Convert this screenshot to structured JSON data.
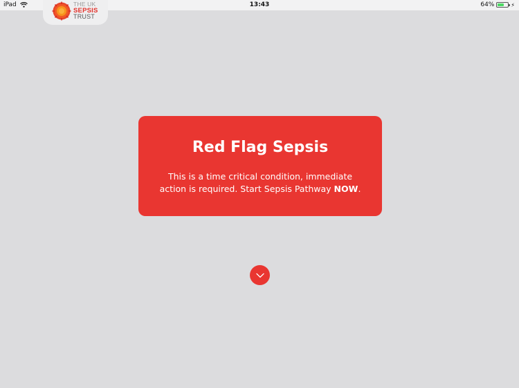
{
  "status_bar": {
    "device": "iPad",
    "time": "13:43",
    "battery_percent": "64%",
    "battery_level": 0.64,
    "battery_color": "#4cd964"
  },
  "logo": {
    "line1": "THE UK",
    "line2": "SEPSIS",
    "line3": "TRUST",
    "icon": "sepsis-trust-flower-icon"
  },
  "alert": {
    "title": "Red Flag Sepsis",
    "message_part1": "This is a time critical condition, immediate action is required. Start Sepsis Pathway ",
    "message_emphasis": "NOW",
    "message_end": ".",
    "background_color": "#e93631"
  },
  "scroll_button": {
    "icon": "chevron-down-icon"
  },
  "colors": {
    "background": "#dcdcde",
    "accent": "#e93631"
  }
}
